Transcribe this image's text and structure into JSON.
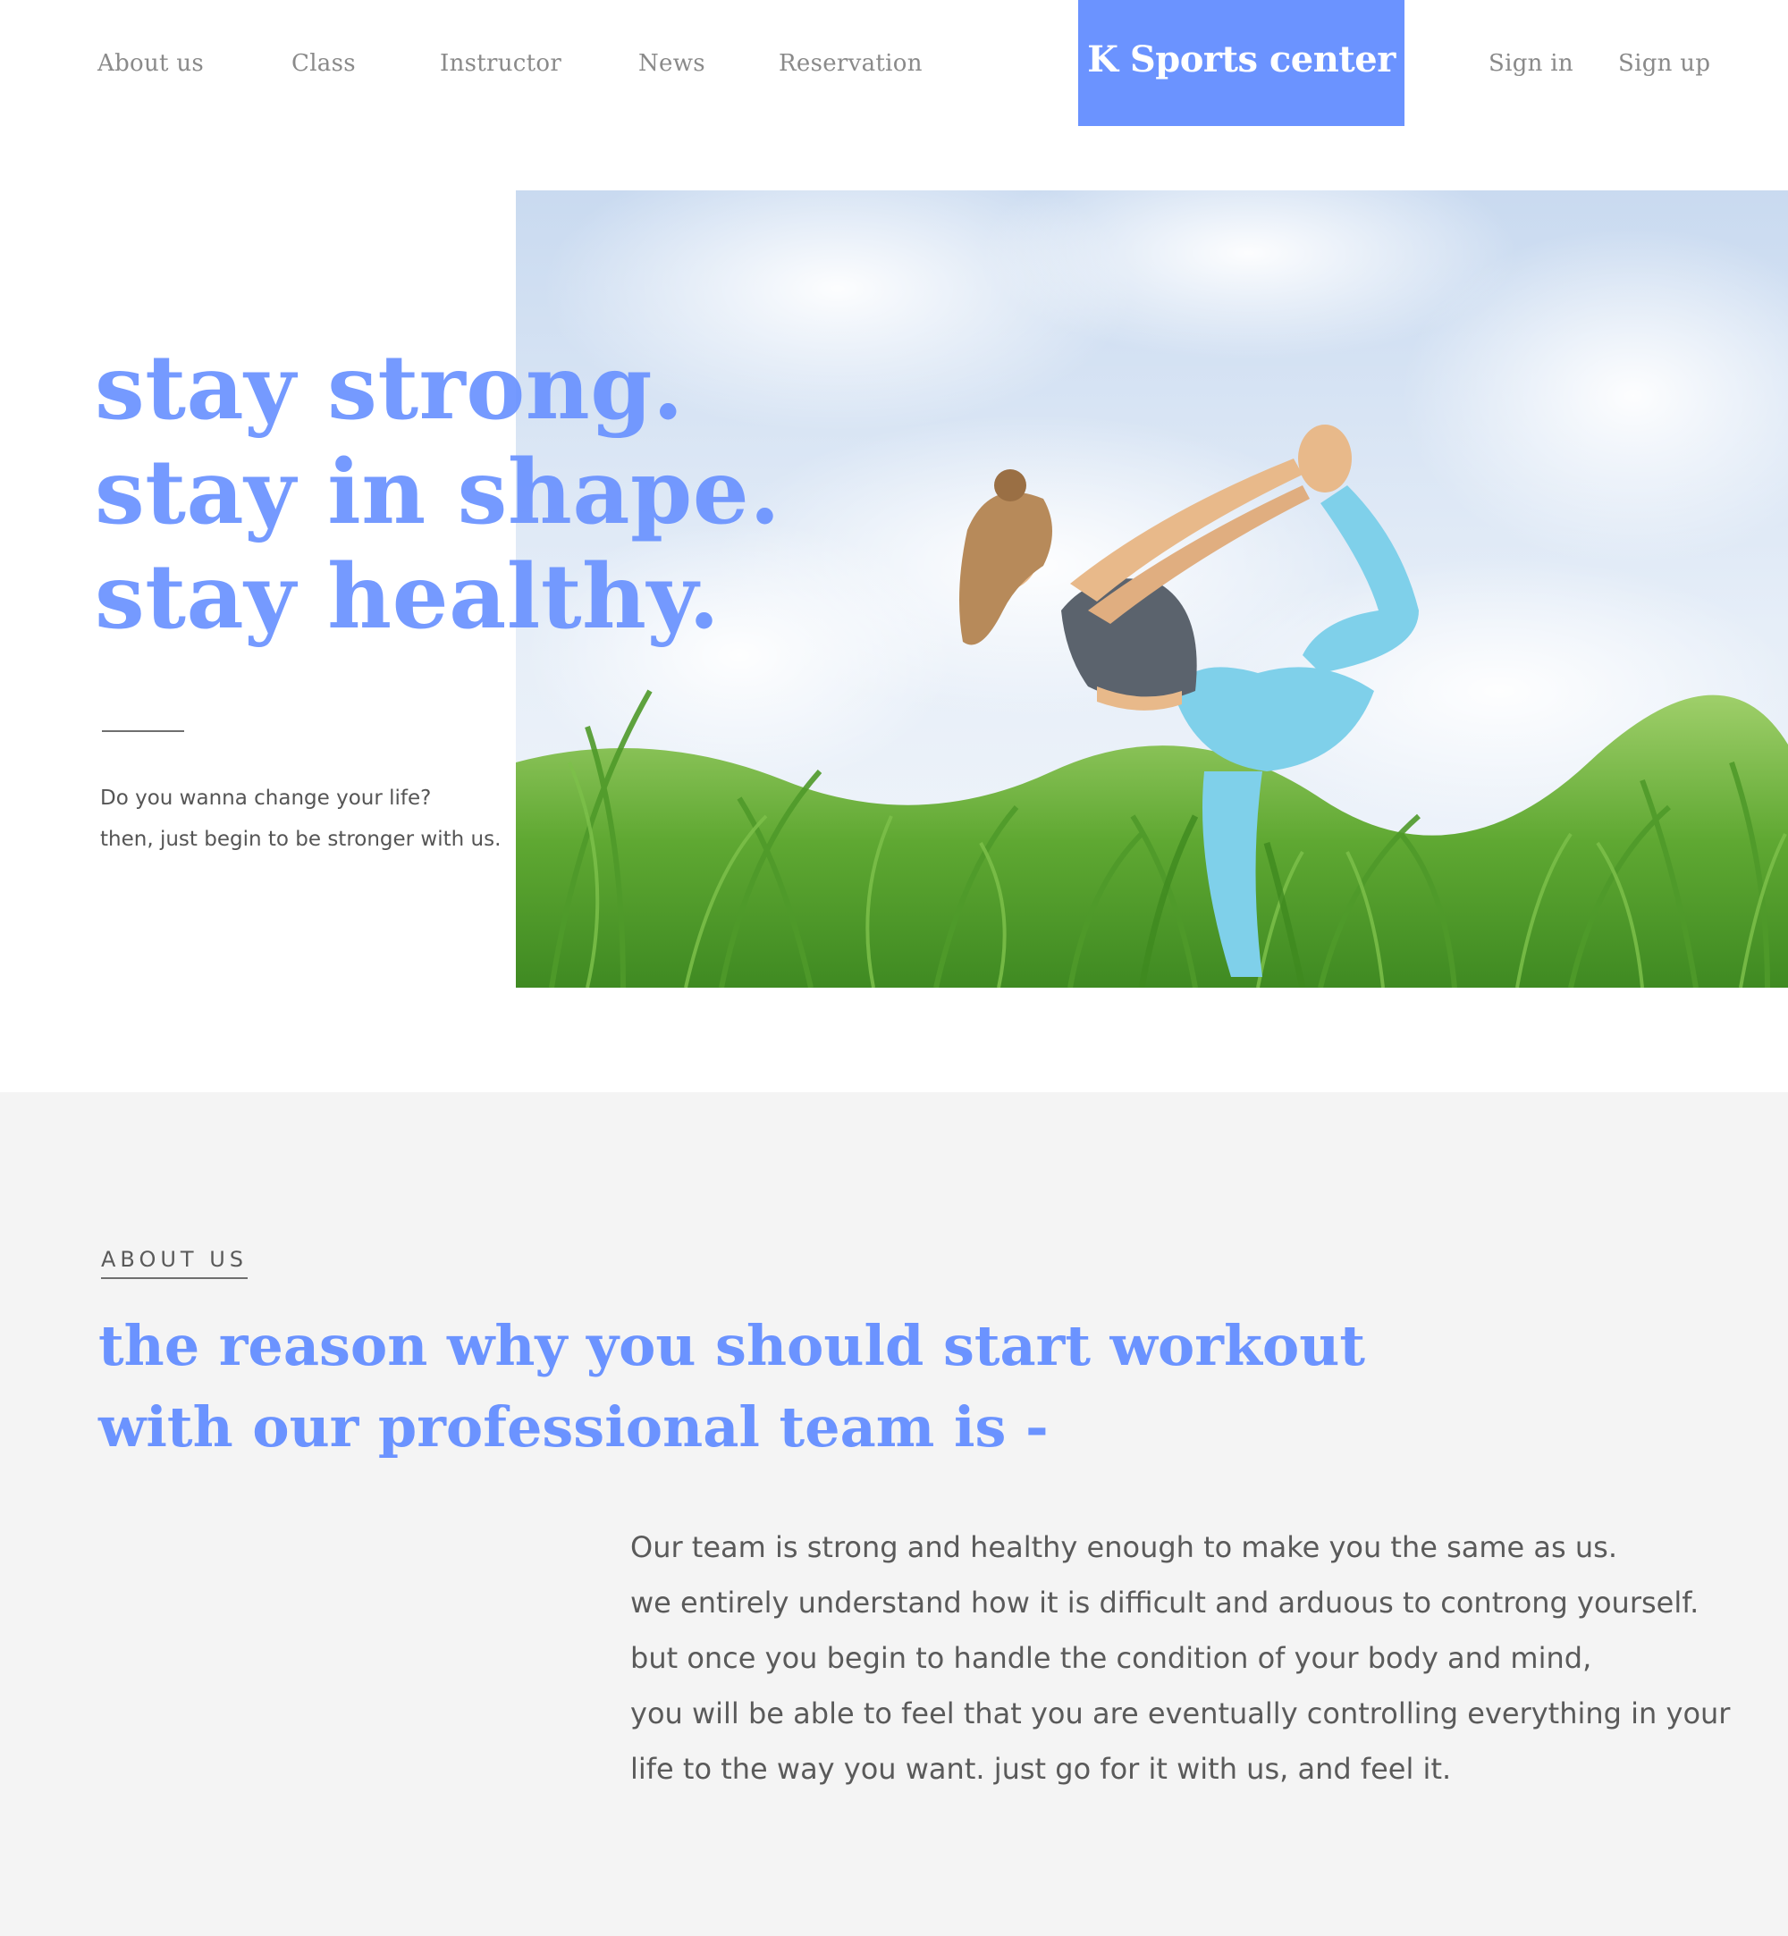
{
  "nav": {
    "items": [
      {
        "label": "About us"
      },
      {
        "label": "Class"
      },
      {
        "label": "Instructor"
      },
      {
        "label": "News"
      },
      {
        "label": "Reservation"
      }
    ],
    "brand": "K Sports center",
    "sign_in": "Sign in",
    "sign_up": "Sign up"
  },
  "hero": {
    "headline": [
      "stay strong.",
      "stay in shape.",
      "stay healthy."
    ],
    "sub": [
      "Do you wanna change your life?",
      "then, just begin to be stronger with us."
    ]
  },
  "about": {
    "kicker": "ABOUT US",
    "heading": [
      "the reason why you should start workout",
      "with our professional team is -"
    ],
    "body": [
      "Our team is strong and healthy enough to make you the same as us.",
      "we entirely understand how it is difficult and arduous to controng yourself.",
      "but once you begin to handle the condition of your body and mind,",
      "you will be able to feel that you are eventually controlling everything in your",
      "life to the way you want. just go for it with us, and feel it."
    ]
  },
  "colors": {
    "accent": "#6b93ff",
    "nav_text": "#8a8a8a",
    "body_text": "#5a5a5a",
    "section_bg": "#f4f4f4"
  }
}
